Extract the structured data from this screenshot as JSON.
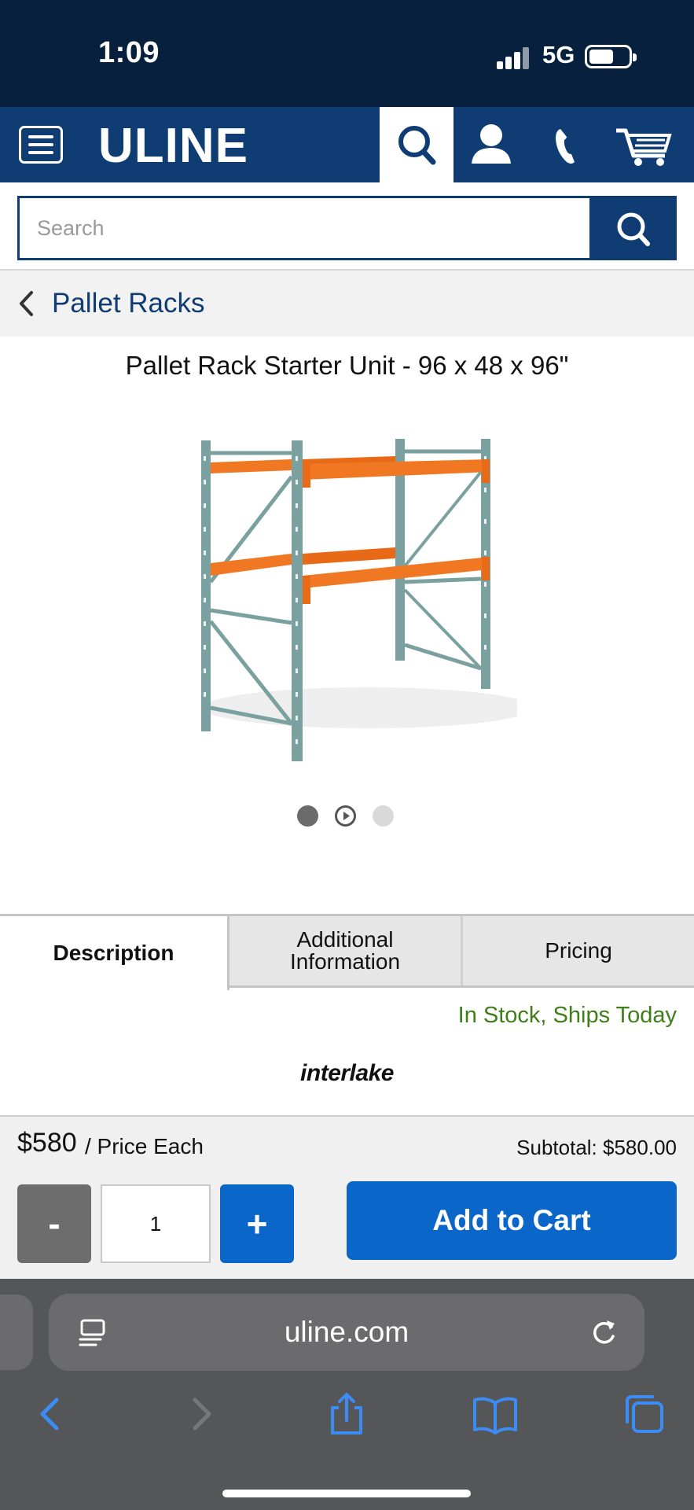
{
  "status_bar": {
    "time": "1:09",
    "network": "5G"
  },
  "header": {
    "logo": "ULINE",
    "menu_icon": "hamburger-menu-icon",
    "search_icon": "search-icon",
    "account_icon": "user-icon",
    "phone_icon": "phone-icon",
    "cart_icon": "cart-icon"
  },
  "search": {
    "placeholder": "Search",
    "value": ""
  },
  "breadcrumb": {
    "label": "Pallet Racks"
  },
  "product": {
    "title": "Pallet Rack Starter Unit - 96 x 48 x 96\"",
    "carousel_dots": 3,
    "carousel_active": 1
  },
  "tabs": [
    {
      "label": "Description",
      "active": true
    },
    {
      "label": "Additional Information",
      "active": false
    },
    {
      "label": "Pricing",
      "active": false
    }
  ],
  "availability": "In Stock, Ships Today",
  "brand": "interlake",
  "purchase": {
    "price": "$580",
    "price_unit": "/ Price Each",
    "subtotal": "Subtotal: $580.00",
    "minus": "-",
    "quantity": "1",
    "plus": "+",
    "add_to_cart": "Add to Cart"
  },
  "browser": {
    "url": "uline.com"
  },
  "colors": {
    "navy": "#0f3d73",
    "status_bar": "#07203d",
    "blue_button": "#0a67c9",
    "stock_green": "#3f7f17",
    "rack_orange": "#f07822",
    "rack_teal": "#7aa1a0"
  }
}
